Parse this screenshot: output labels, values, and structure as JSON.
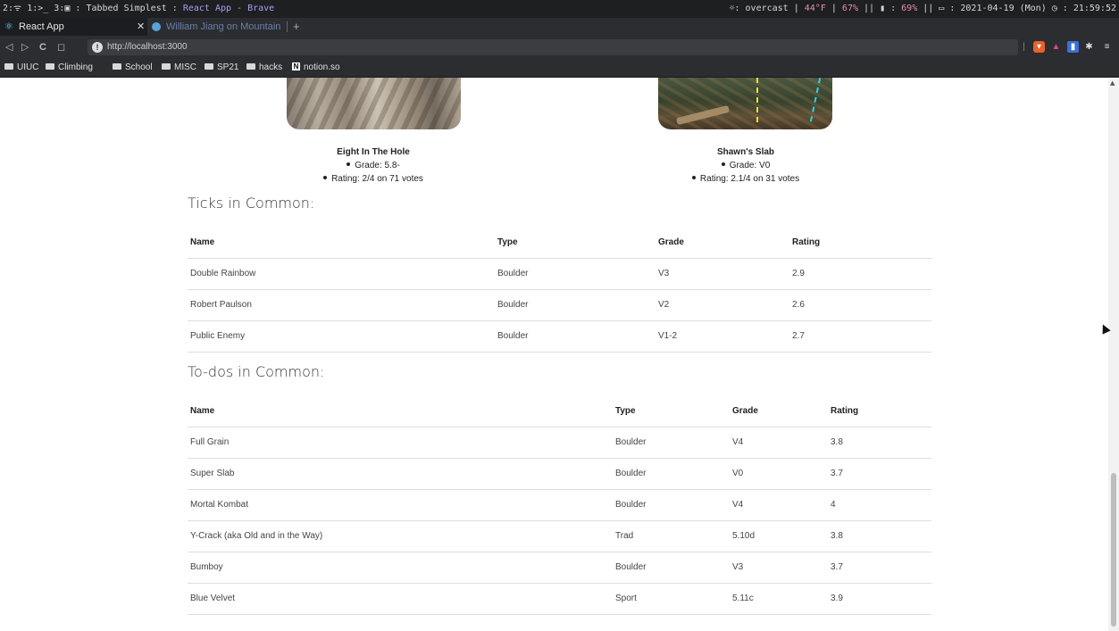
{
  "statusbar": {
    "workspaces": "2:ᯤ 1:>_ 3:▣ :",
    "app_prefix": "Tabbed Simplest :",
    "window_title": "React App - Brave",
    "weather": "☼: overcast | ",
    "temp": "44°F",
    "sep1": " | ",
    "humidity": "67%",
    "sep2": " || ▮ : ",
    "battery": "69%",
    "sep3": " || ▭ : ",
    "date": "2021-04-19 (Mon)",
    "time": " ◷ : 21:59:52"
  },
  "tabs": [
    {
      "label": "React App",
      "icon": "react-icon",
      "active": true
    },
    {
      "label": "William Jiang on Mountain Proje",
      "icon": "mountain-project-icon",
      "active": false
    }
  ],
  "nav": {
    "url": "http://localhost:3000",
    "back": "◁",
    "forward": "▷",
    "reload": "C",
    "bookmark": "◻",
    "menu": "≡"
  },
  "bookmarks": [
    "UIUC",
    "Climbing",
    "School",
    "MISC",
    "SP21",
    "hacks",
    "notion.so"
  ],
  "climbs": [
    {
      "name": "Eight In The Hole",
      "grade": "Grade: 5.8-",
      "rating": "Rating: 2/4 on 71 votes"
    },
    {
      "name": "Shawn's Slab",
      "grade": "Grade: V0",
      "rating": "Rating: 2.1/4 on 31 votes"
    }
  ],
  "ticks": {
    "title": "Ticks in Common:",
    "headers": [
      "Name",
      "Type",
      "Grade",
      "Rating"
    ],
    "rows": [
      [
        "Double Rainbow",
        "Boulder",
        "V3",
        "2.9"
      ],
      [
        "Robert Paulson",
        "Boulder",
        "V2",
        "2.6"
      ],
      [
        "Public Enemy",
        "Boulder",
        "V1-2",
        "2.7"
      ]
    ]
  },
  "todos": {
    "title": "To-dos in Common:",
    "headers": [
      "Name",
      "Type",
      "Grade",
      "Rating"
    ],
    "rows": [
      [
        "Full Grain",
        "Boulder",
        "V4",
        "3.8"
      ],
      [
        "Super Slab",
        "Boulder",
        "V0",
        "3.7"
      ],
      [
        "Mortal Kombat",
        "Boulder",
        "V4",
        "4"
      ],
      [
        "Y-Crack (aka Old and in the Way)",
        "Trad",
        "5.10d",
        "3.8"
      ],
      [
        "Bumboy",
        "Boulder",
        "V3",
        "3.7"
      ],
      [
        "Blue Velvet",
        "Sport",
        "5.11c",
        "3.9"
      ]
    ]
  }
}
